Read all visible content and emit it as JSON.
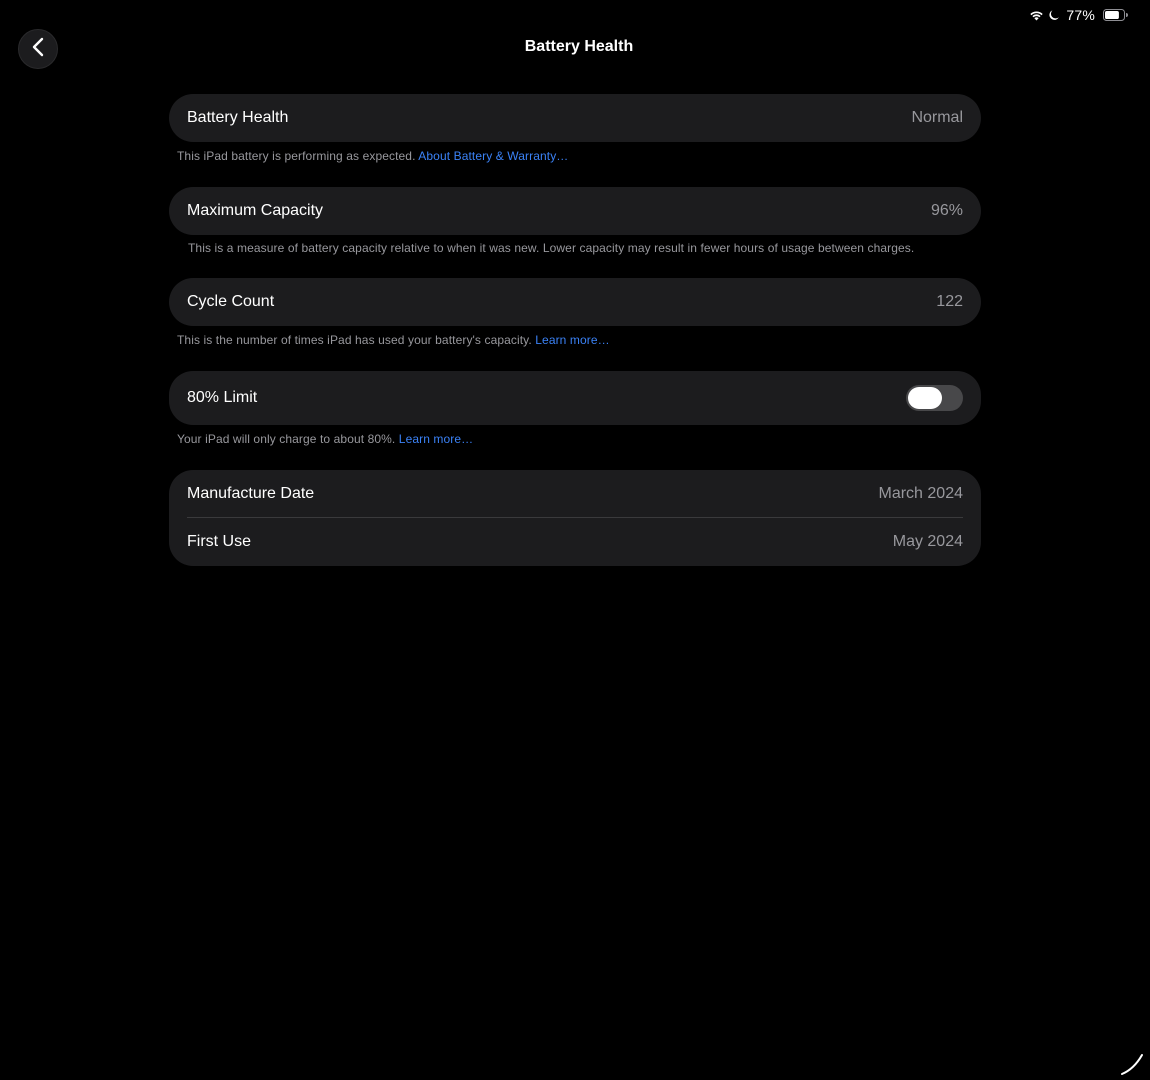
{
  "status_bar": {
    "wifi_icon": "wifi-icon",
    "moon_icon": "moon-icon",
    "battery_percent": "77%",
    "battery_icon": "battery-icon",
    "battery_level": 0.77
  },
  "header": {
    "back_icon": "chevron-left-icon",
    "title": "Battery Health"
  },
  "battery_health": {
    "label": "Battery Health",
    "value": "Normal",
    "note": "This iPad battery is performing as expected.",
    "link": "About Battery & Warranty…"
  },
  "maximum_capacity": {
    "label": "Maximum Capacity",
    "value": "96%",
    "note": "This is a measure of battery capacity relative to when it was new. Lower capacity may result in fewer hours of usage between charges."
  },
  "cycle_count": {
    "label": "Cycle Count",
    "value": "122",
    "note": "This is the number of times iPad has used your battery's capacity.",
    "link": "Learn more…"
  },
  "limit": {
    "label": "80% Limit",
    "enabled": false,
    "note": "Your iPad will only charge to about 80%.",
    "link": "Learn more…"
  },
  "dates": {
    "manufacture_label": "Manufacture Date",
    "manufacture_value": "March 2024",
    "first_use_label": "First Use",
    "first_use_value": "May 2024"
  },
  "colors": {
    "background": "#000000",
    "card": "#1c1c1e",
    "secondary_text": "#98989d",
    "link": "#3b82f6",
    "toggle_off": "#48484a"
  }
}
